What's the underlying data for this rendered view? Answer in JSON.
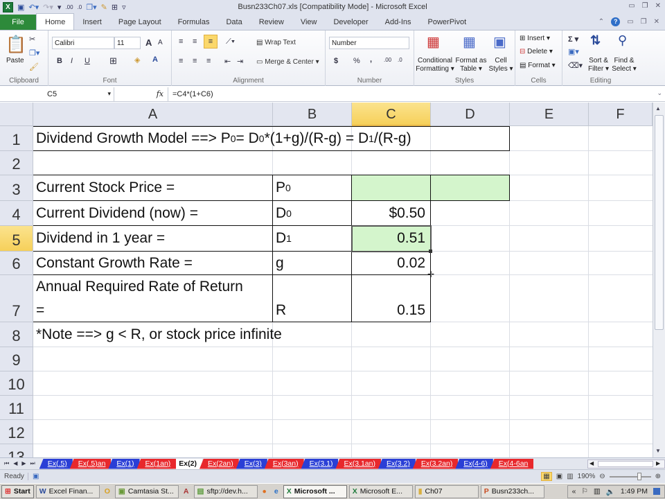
{
  "window": {
    "title": "Busn233Ch07.xls  [Compatibility Mode]  -  Microsoft Excel",
    "controls": [
      "minimize",
      "restore",
      "close"
    ]
  },
  "ribbon_tabs": [
    "File",
    "Home",
    "Insert",
    "Page Layout",
    "Formulas",
    "Data",
    "Review",
    "View",
    "Developer",
    "Add-Ins",
    "PowerPivot"
  ],
  "active_tab": "Home",
  "ribbon": {
    "clipboard": {
      "label": "Clipboard",
      "paste": "Paste"
    },
    "font": {
      "label": "Font",
      "font_name": "Calibri",
      "font_size": "11",
      "bold": "B",
      "italic": "I",
      "underline": "U"
    },
    "alignment": {
      "label": "Alignment",
      "wrap_text": "Wrap Text",
      "merge_center": "Merge & Center"
    },
    "number": {
      "label": "Number",
      "format": "Number",
      "currency": "$",
      "percent": "%",
      "comma": ","
    },
    "styles": {
      "label": "Styles",
      "conditional": [
        "Conditional",
        "Formatting"
      ],
      "format_table": [
        "Format as",
        "Table"
      ],
      "cell_styles": [
        "Cell",
        "Styles"
      ]
    },
    "cells": {
      "label": "Cells",
      "insert": "Insert",
      "delete": "Delete",
      "format": "Format"
    },
    "editing": {
      "label": "Editing",
      "sort": [
        "Sort &",
        "Filter"
      ],
      "find": [
        "Find &",
        "Select"
      ],
      "sum": "Σ"
    }
  },
  "formula_bar": {
    "name_box": "C5",
    "fx": "fx",
    "formula": "=C4*(1+C6)"
  },
  "columns": [
    "A",
    "B",
    "C",
    "D",
    "E",
    "F"
  ],
  "selected_column": "C",
  "rows": [
    "1",
    "2",
    "3",
    "4",
    "5",
    "6",
    "7",
    "8",
    "9",
    "10",
    "11",
    "12",
    "13"
  ],
  "selected_row": "5",
  "cells": {
    "A1": {
      "pre": "Dividend Growth Model ==> P",
      "s1": "0",
      "mid1": " = D",
      "s2": "0",
      "mid2": "*(1+g)/(R-g) = D",
      "s3": "1",
      "post": "/(R-g)"
    },
    "A3": "Current Stock Price =",
    "B3": {
      "main": "P",
      "sub": "0"
    },
    "A4": "Current Dividend (now) =",
    "B4": {
      "main": "D",
      "sub": "0"
    },
    "C4": "$0.50",
    "A5": "Dividend in 1 year =",
    "B5": {
      "main": "D",
      "sub": "1"
    },
    "C5": "0.51",
    "A6": "Constant Growth Rate =",
    "B6": "g",
    "C6": "0.02",
    "A7_line1": "Annual Required Rate of Return",
    "A7_line2": "=",
    "B7": "R",
    "C7": "0.15",
    "A8": "*Note ==> g < R, or stock price infinite"
  },
  "highlight_color": "#d4f5cc",
  "sheet_tabs": [
    {
      "label": "Ex(.5)",
      "color": "blue"
    },
    {
      "label": "Ex(.5)an",
      "color": "red"
    },
    {
      "label": "Ex(1)",
      "color": "blue"
    },
    {
      "label": "Ex(1an)",
      "color": "red"
    },
    {
      "label": "Ex(2)",
      "color": "active"
    },
    {
      "label": "Ex(2an)",
      "color": "red"
    },
    {
      "label": "Ex(3)",
      "color": "blue"
    },
    {
      "label": "Ex(3an)",
      "color": "red"
    },
    {
      "label": "Ex(3.1)",
      "color": "blue"
    },
    {
      "label": "Ex(3.1an)",
      "color": "red"
    },
    {
      "label": "Ex(3.2)",
      "color": "blue"
    },
    {
      "label": "Ex(3.2an)",
      "color": "red"
    },
    {
      "label": "Ex(4-6)",
      "color": "blue"
    },
    {
      "label": "Ex(4-6an",
      "color": "red"
    }
  ],
  "status": {
    "mode": "Ready",
    "zoom": "190%"
  },
  "taskbar": {
    "start": "Start",
    "items": [
      {
        "label": "Excel Finan...",
        "icon": "word-icon"
      },
      {
        "label": "",
        "icon": "outlook-icon"
      },
      {
        "label": "Camtasia St...",
        "icon": "camtasia-icon"
      },
      {
        "label": "",
        "icon": "access-icon"
      },
      {
        "label": "sftp://dev.h...",
        "icon": "sftp-icon"
      },
      {
        "label": "",
        "icon": "firefox-icon"
      },
      {
        "label": "",
        "icon": "ie-icon"
      },
      {
        "label": "Microsoft ...",
        "icon": "excel-icon",
        "active": true
      },
      {
        "label": "Microsoft E...",
        "icon": "excel-icon"
      },
      {
        "label": "Ch07",
        "icon": "folder-icon"
      },
      {
        "label": "Busn233ch...",
        "icon": "powerpoint-icon"
      }
    ],
    "clock": "1:49 PM"
  }
}
